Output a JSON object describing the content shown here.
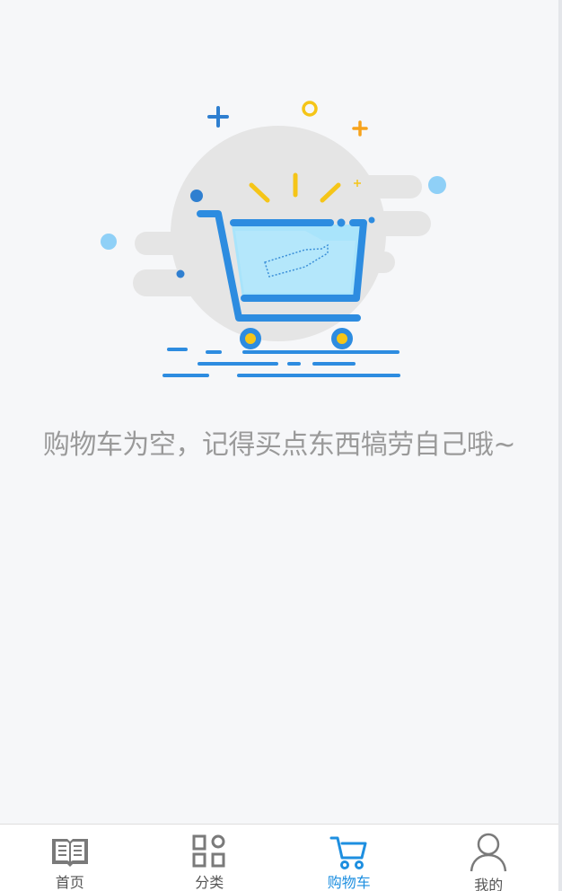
{
  "empty_cart": {
    "message": "购物车为空，记得买点东西犒劳自己哦~"
  },
  "tabbar": {
    "items": [
      {
        "label": "首页",
        "icon": "book-icon",
        "active": false
      },
      {
        "label": "分类",
        "icon": "grid-icon",
        "active": false
      },
      {
        "label": "购物车",
        "icon": "cart-icon",
        "active": true
      },
      {
        "label": "我的",
        "icon": "user-icon",
        "active": false
      }
    ]
  },
  "colors": {
    "accent": "#1e8fe0",
    "inactive_icon": "#7a7a7a",
    "message_text": "#9a9a9a",
    "background": "#f6f7f9"
  }
}
